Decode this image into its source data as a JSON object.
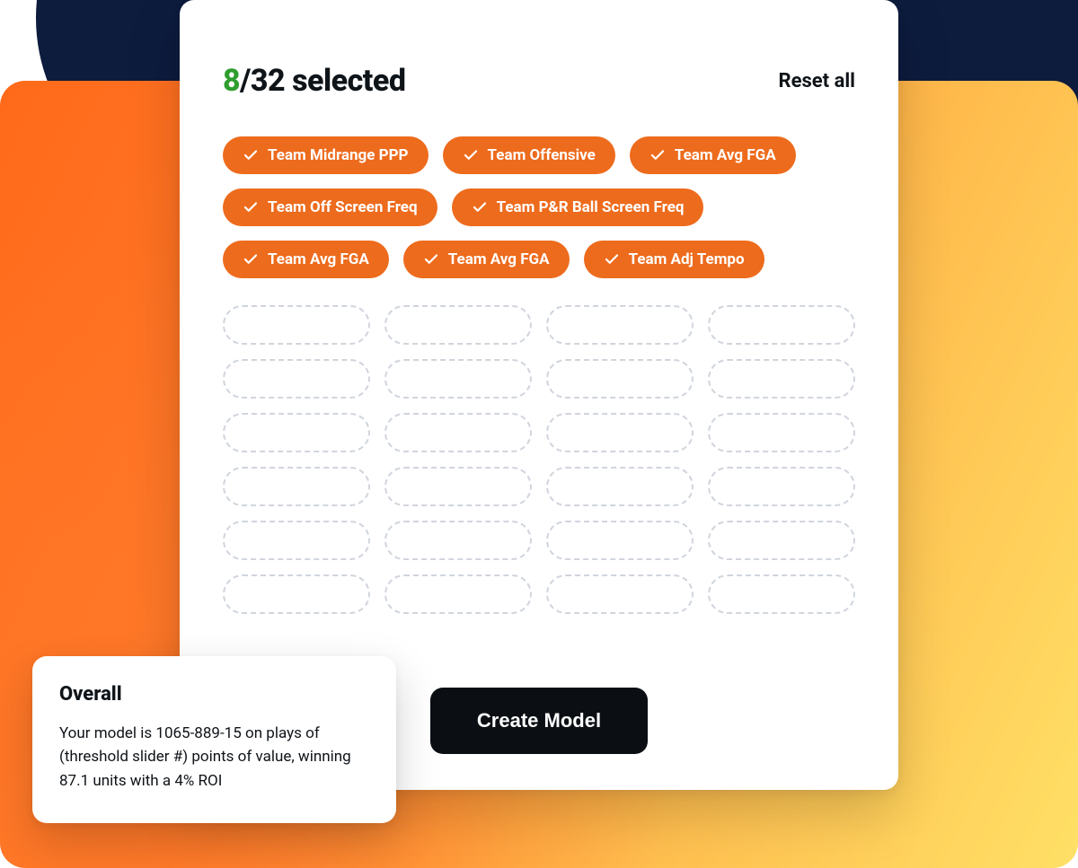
{
  "selection": {
    "selected_count": "8",
    "total_count": "32",
    "suffix": " selected"
  },
  "reset_label": "Reset all",
  "chips": [
    "Team Midrange PPP",
    "Team Offensive",
    "Team Avg FGA",
    "Team Off Screen Freq",
    "Team P&R Ball Screen Freq",
    "Team Avg FGA",
    "Team Avg FGA",
    "Team Adj Tempo"
  ],
  "empty_slot_rows": 6,
  "empty_slot_cols": 4,
  "create_button_label": "Create Model",
  "overall": {
    "title": "Overall",
    "body": "Your model is 1065-889-15 on plays of (threshold slider #) points of value, winning 87.1 units with a 4% ROI"
  }
}
